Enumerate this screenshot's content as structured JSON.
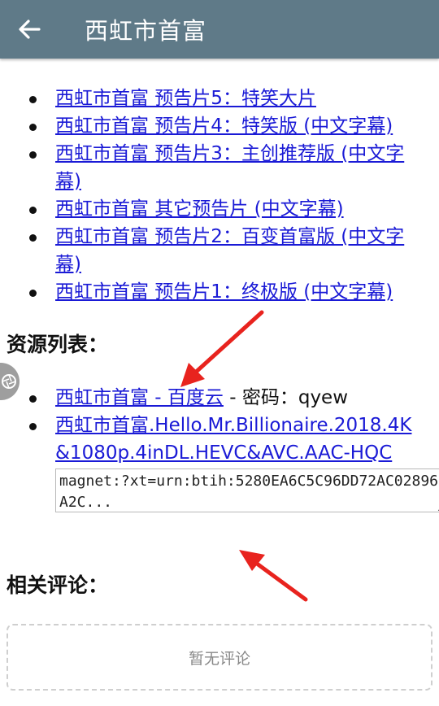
{
  "appbar": {
    "title": "西虹市首富",
    "back_icon": "arrow-left-icon"
  },
  "trailers": [
    "西虹市首富 预告片5：特笑大片",
    "西虹市首富 预告片4：特笑版 (中文字幕)",
    "西虹市首富 预告片3：主创推荐版 (中文字幕)",
    "西虹市首富 其它预告片 (中文字幕)",
    "西虹市首富 预告片2：百变首富版 (中文字幕)",
    "西虹市首富 预告片1：终极版 (中文字幕)"
  ],
  "resources": {
    "heading": "资源列表：",
    "baidu": {
      "link": "西虹市首富 - 百度云",
      "suffix": " - 密码：qyew"
    },
    "torrent": {
      "link": "西虹市首富.Hello.Mr.Billionaire.2018.4K&1080p.4inDL.HEVC&AVC.AAC-HQC",
      "magnet": "magnet:?xt=urn:btih:5280EA6C5C96DD72AC02896A2C..."
    }
  },
  "comments": {
    "heading": "相关评论：",
    "empty": "暂无评论"
  },
  "colors": {
    "appbar": "#5f7a88",
    "link": "#1a1ad6",
    "annotation_arrow": "#e8231e"
  }
}
